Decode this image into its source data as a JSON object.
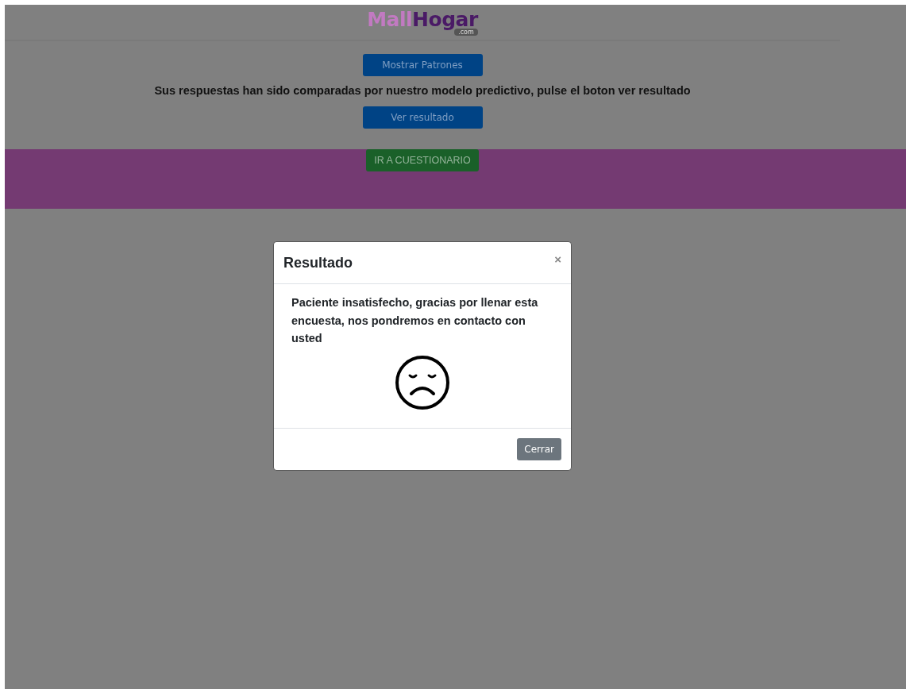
{
  "logo": {
    "first": "Mall",
    "second": "Hogar",
    "suffix": ".com"
  },
  "buttons": [
    {
      "label": "Mostrar Patrones"
    },
    {
      "label": "Ver resultado"
    }
  ],
  "message": "Sus respuestas han sido comparadas por nuestro modelo predictivo, pulse el boton ver resultado",
  "band": {
    "button": "IR A CUESTIONARIO"
  },
  "modal": {
    "title": "Resultado",
    "close": "×",
    "body": "Paciente insatisfecho, gracias por llenar esta encuesta, nos pondremos en contacto con usted",
    "footer_button": "Cerrar"
  }
}
